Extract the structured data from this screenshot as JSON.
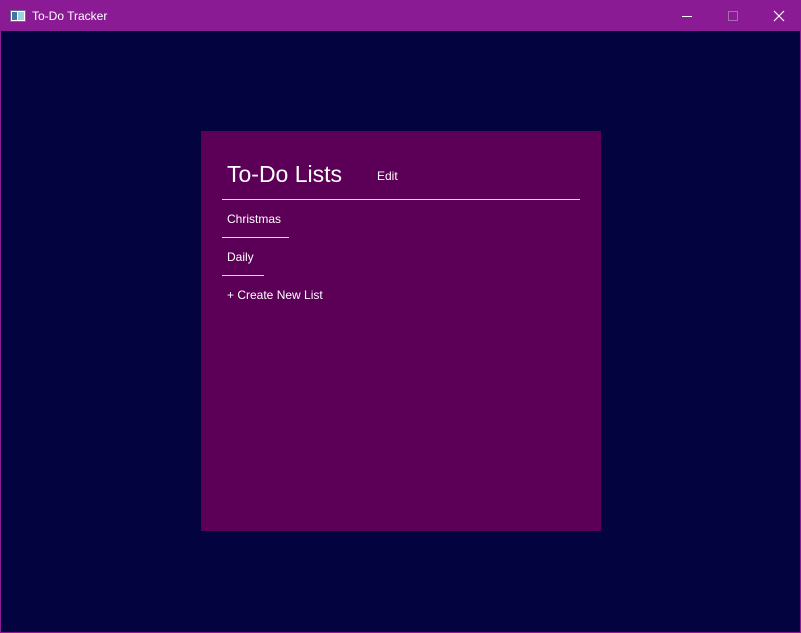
{
  "window": {
    "title": "To-Do Tracker",
    "controls": {
      "minimize": "minimize-icon",
      "maximize": "maximize-icon",
      "close": "close-icon"
    }
  },
  "panel": {
    "title": "To-Do Lists",
    "edit_label": "Edit",
    "lists": [
      {
        "label": "Christmas"
      },
      {
        "label": "Daily"
      }
    ],
    "create_label": "+ Create New List"
  },
  "colors": {
    "titlebar": "#8b1a95",
    "background": "#030340",
    "panel": "#5c0057",
    "text": "#ffffff"
  }
}
